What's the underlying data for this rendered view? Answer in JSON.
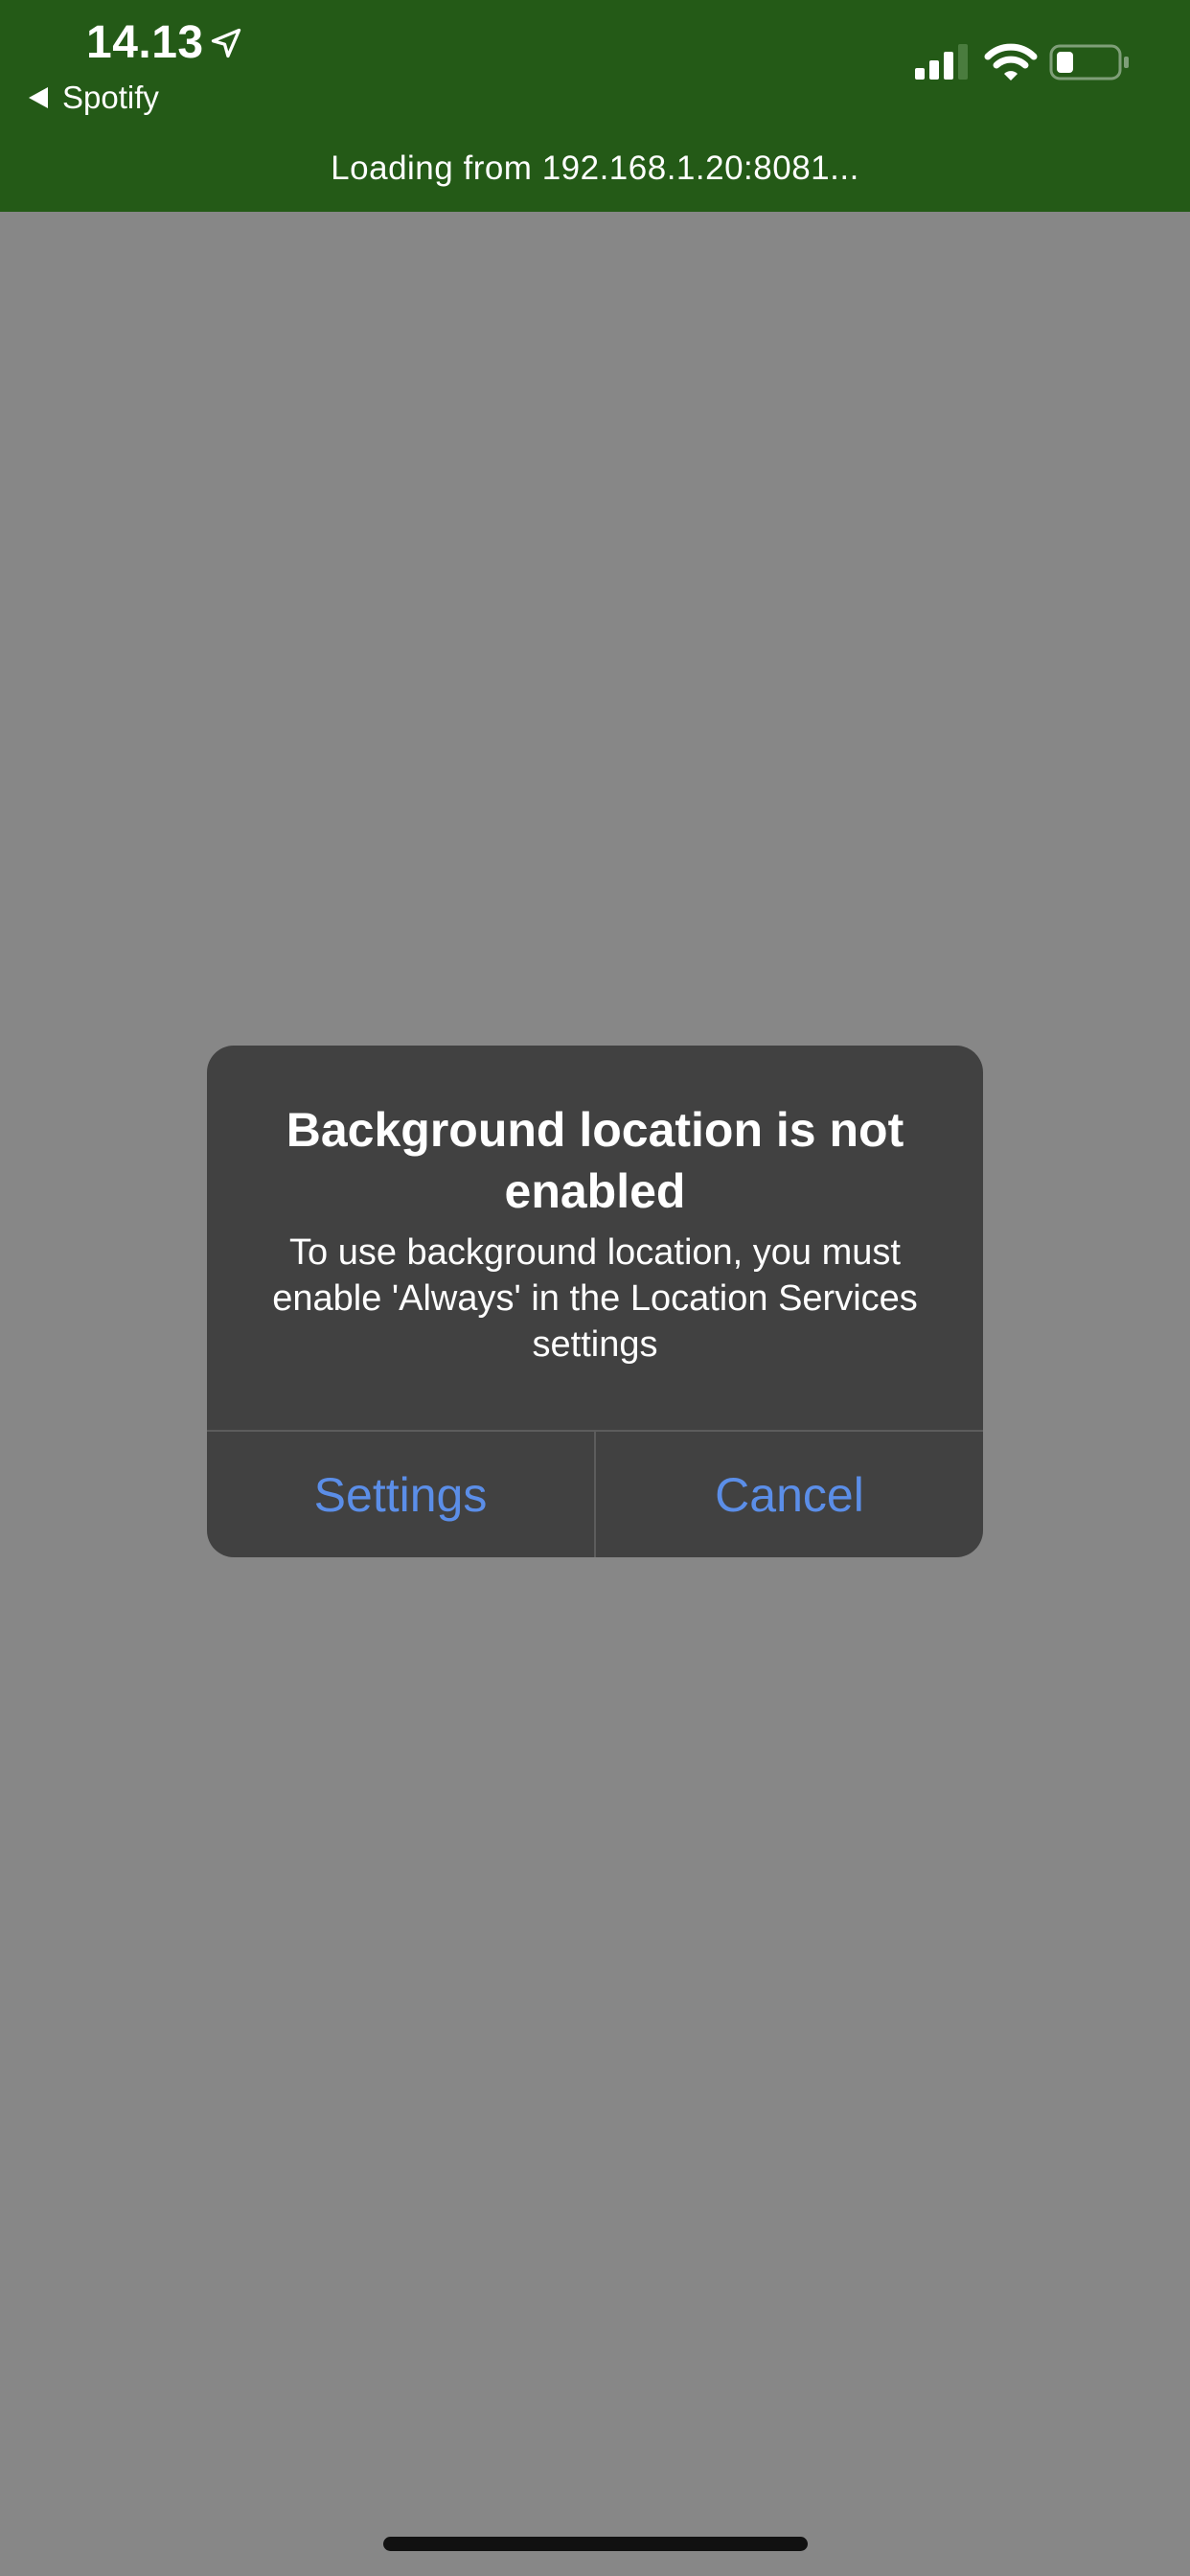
{
  "status_bar": {
    "time": "14.13",
    "back_app": "Spotify",
    "icons": [
      "location-arrow-icon",
      "cellular-signal-icon",
      "wifi-icon",
      "battery-icon"
    ]
  },
  "banner": {
    "text": "Loading from 192.168.1.20:8081..."
  },
  "alert": {
    "title": "Background location is not enabled",
    "message": "To use background location, you must enable 'Always' in the Location Services settings",
    "buttons": {
      "settings": "Settings",
      "cancel": "Cancel"
    }
  },
  "colors": {
    "banner_bg": "#245a17",
    "background": "#878787",
    "dialog_bg": "#414141",
    "button_text": "#5b8ee8"
  }
}
